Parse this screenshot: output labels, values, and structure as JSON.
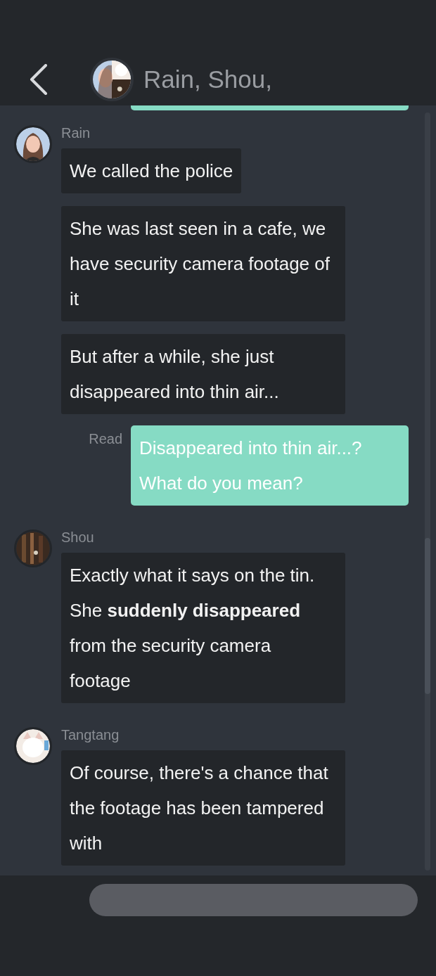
{
  "header": {
    "title": "Rain, Shou,"
  },
  "messages": [
    {
      "kind": "incoming",
      "sender": "Rain",
      "bubbles": [
        "We called the police",
        "She was last seen in a cafe, we have security camera footage of it",
        "But after a while, she just disappeared into thin air..."
      ]
    },
    {
      "kind": "outgoing",
      "status": "Read",
      "bubbles": [
        "Disappeared into thin air...? What do you mean?"
      ]
    },
    {
      "kind": "incoming",
      "sender": "Shou",
      "bubbles": [
        "Exactly what it says on the tin. She **suddenly disappeared** from the security camera footage"
      ]
    },
    {
      "kind": "incoming",
      "sender": "Tangtang",
      "bubbles": [
        "Of course, there's a chance that the footage has been tampered with"
      ]
    }
  ]
}
